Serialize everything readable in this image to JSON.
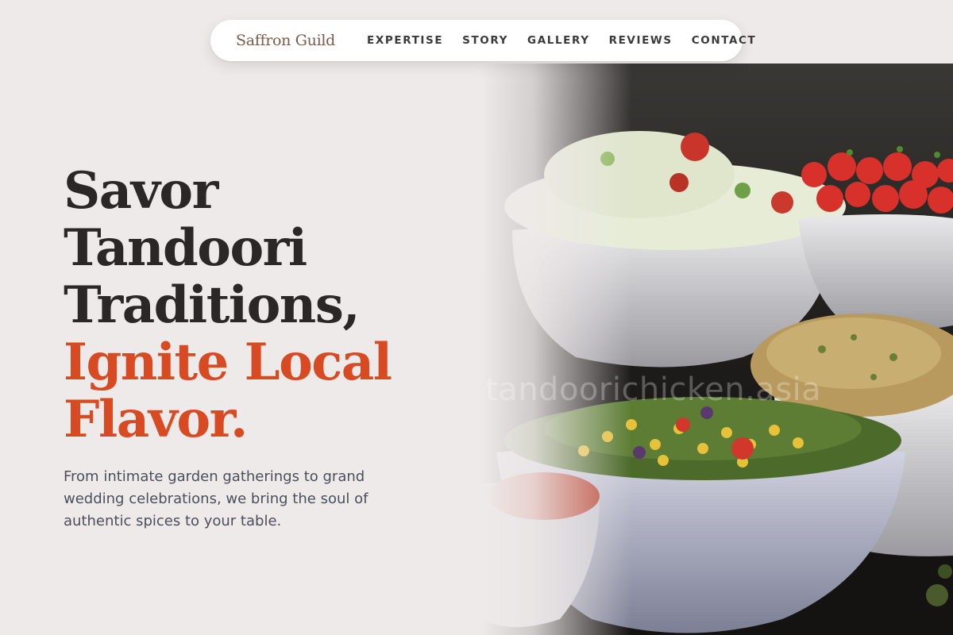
{
  "nav": {
    "brand": "Saffron Guild",
    "links": [
      {
        "label": "EXPERTISE"
      },
      {
        "label": "STORY"
      },
      {
        "label": "GALLERY"
      },
      {
        "label": "REVIEWS"
      },
      {
        "label": "CONTACT"
      }
    ]
  },
  "hero": {
    "headline_lines": [
      "Savor",
      "Tandoori",
      "Traditions,"
    ],
    "accent_lines": [
      "Ignite Local",
      "Flavor."
    ],
    "subtext": "From intimate garden gatherings to grand wedding celebrations, we bring the soul of authentic spices to your table.",
    "watermark": "tandoorichicken.asia"
  },
  "colors": {
    "background": "#efeaea",
    "accent": "#d84a22",
    "heading": "#2b2726",
    "body_text": "#4a4f5a",
    "brand": "#7a5a4a"
  }
}
